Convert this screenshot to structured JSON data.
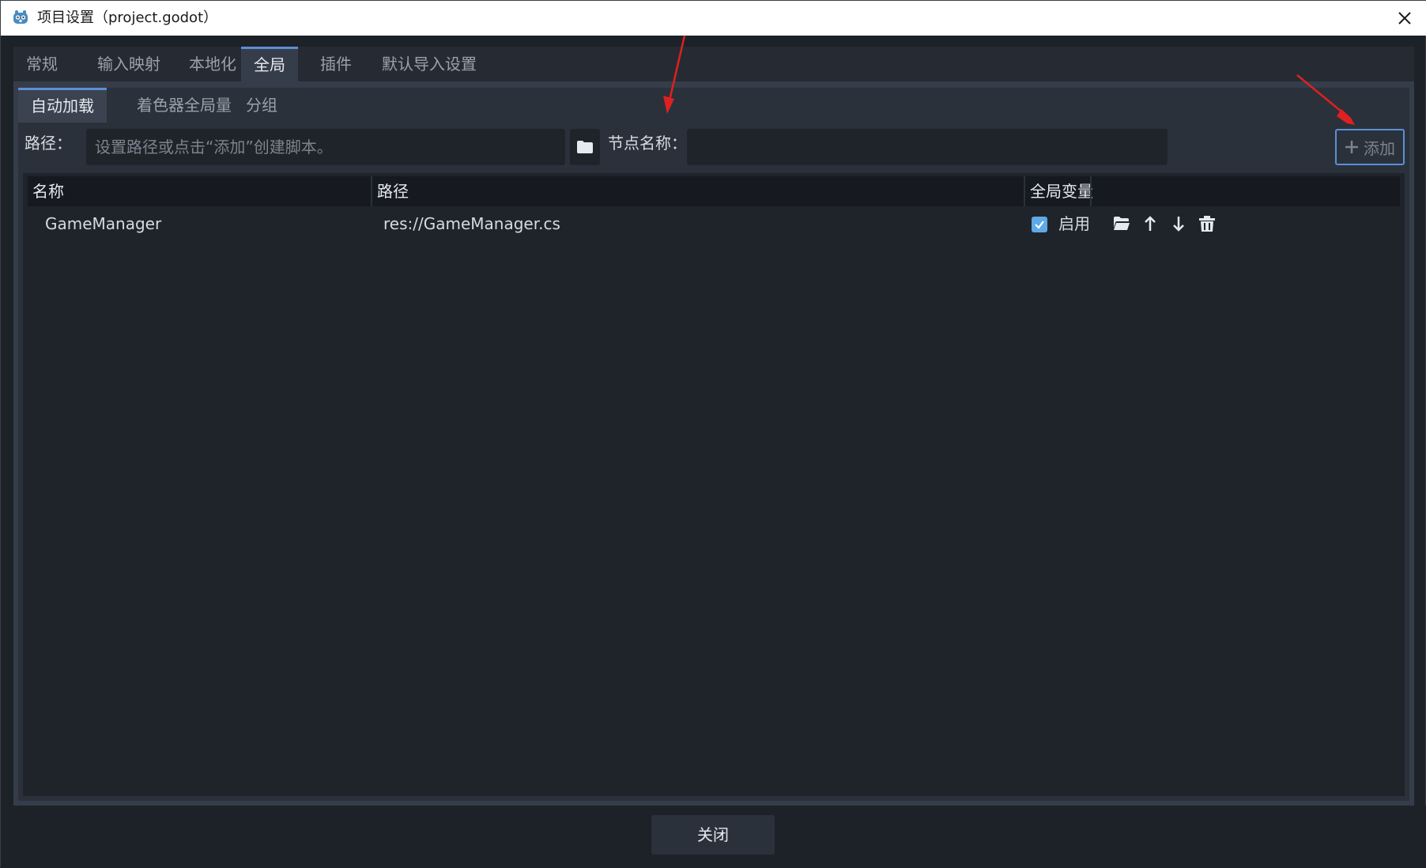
{
  "window": {
    "title": "项目设置（project.godot）",
    "app_icon": "godot-icon"
  },
  "main_tabs": [
    {
      "label": "常规",
      "active": false
    },
    {
      "label": "输入映射",
      "active": false
    },
    {
      "label": "本地化",
      "active": false
    },
    {
      "label": "全局",
      "active": true
    },
    {
      "label": "插件",
      "active": false
    },
    {
      "label": "默认导入设置",
      "active": false
    }
  ],
  "sub_tabs": [
    {
      "label": "自动加载",
      "active": true
    },
    {
      "label": "着色器全局量",
      "active": false
    },
    {
      "label": "分组",
      "active": false
    }
  ],
  "form": {
    "path_label": "路径：",
    "path_placeholder": "设置路径或点击“添加”创建脚本。",
    "path_value": "",
    "node_name_label": "节点名称：",
    "node_name_value": "",
    "add_label": "添加"
  },
  "table": {
    "columns": [
      "名称",
      "路径",
      "全局变量"
    ],
    "rows": [
      {
        "name": "GameManager",
        "path": "res://GameManager.cs",
        "global": true,
        "global_label": "启用"
      }
    ]
  },
  "footer": {
    "close_label": "关闭"
  },
  "colors": {
    "accent": "#5c8fd6",
    "checkbox": "#5ea9e8",
    "annotation_arrow": "#e02020"
  }
}
